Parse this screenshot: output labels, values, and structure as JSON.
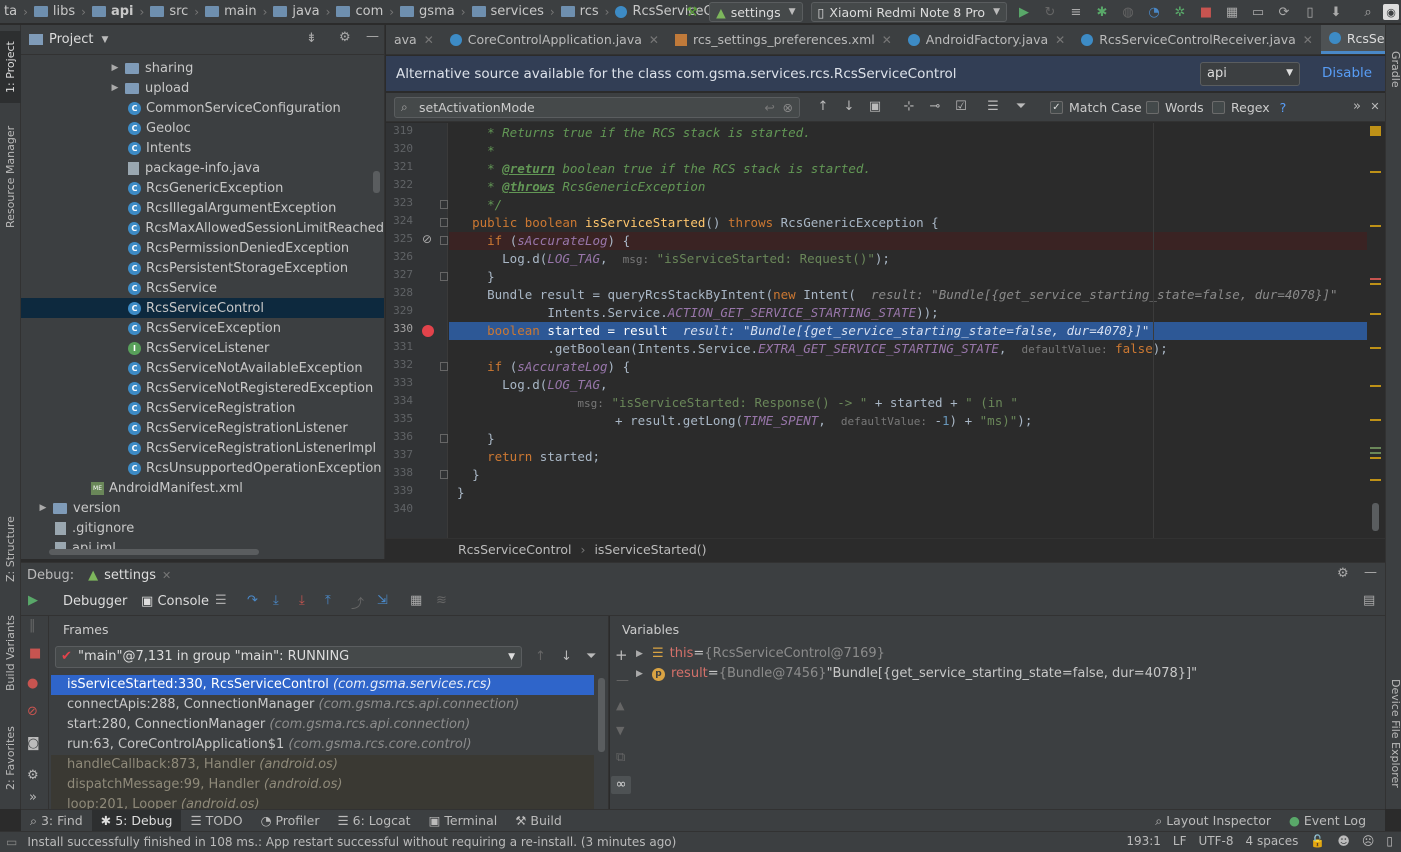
{
  "navbar": {
    "crumbs": [
      "ta",
      "libs",
      "api",
      "src",
      "main",
      "java",
      "com",
      "gsma",
      "services",
      "rcs",
      "RcsServiceControl"
    ],
    "run_config": "settings",
    "device": "Xiaomi Redmi Note 8 Pro"
  },
  "project": {
    "title": "Project",
    "items": [
      {
        "label": "sharing",
        "kind": "folder",
        "expandable": true,
        "indent": 1
      },
      {
        "label": "upload",
        "kind": "folder",
        "expandable": true,
        "indent": 1
      },
      {
        "label": "CommonServiceConfiguration",
        "kind": "class",
        "indent": 2
      },
      {
        "label": "Geoloc",
        "kind": "class",
        "indent": 2
      },
      {
        "label": "Intents",
        "kind": "class",
        "indent": 2
      },
      {
        "label": "package-info.java",
        "kind": "file",
        "indent": 2
      },
      {
        "label": "RcsGenericException",
        "kind": "class",
        "indent": 2
      },
      {
        "label": "RcsIllegalArgumentException",
        "kind": "class",
        "indent": 2
      },
      {
        "label": "RcsMaxAllowedSessionLimitReached",
        "kind": "class",
        "indent": 2
      },
      {
        "label": "RcsPermissionDeniedException",
        "kind": "class",
        "indent": 2
      },
      {
        "label": "RcsPersistentStorageException",
        "kind": "class",
        "indent": 2
      },
      {
        "label": "RcsService",
        "kind": "class",
        "indent": 2
      },
      {
        "label": "RcsServiceControl",
        "kind": "class",
        "indent": 2,
        "selected": true
      },
      {
        "label": "RcsServiceException",
        "kind": "class",
        "indent": 2
      },
      {
        "label": "RcsServiceListener",
        "kind": "interface",
        "indent": 2
      },
      {
        "label": "RcsServiceNotAvailableException",
        "kind": "class",
        "indent": 2
      },
      {
        "label": "RcsServiceNotRegisteredException",
        "kind": "class",
        "indent": 2
      },
      {
        "label": "RcsServiceRegistration",
        "kind": "class",
        "indent": 2
      },
      {
        "label": "RcsServiceRegistrationListener",
        "kind": "class",
        "indent": 2
      },
      {
        "label": "RcsServiceRegistrationListenerImpl",
        "kind": "class",
        "indent": 2
      },
      {
        "label": "RcsUnsupportedOperationException",
        "kind": "class",
        "indent": 2
      },
      {
        "label": "AndroidManifest.xml",
        "kind": "xml",
        "indent": 1
      },
      {
        "label": "version",
        "kind": "folder",
        "expandable": true,
        "indent": 0
      },
      {
        "label": ".gitignore",
        "kind": "file",
        "indent": 0
      },
      {
        "label": "api.iml",
        "kind": "file",
        "indent": 0
      }
    ]
  },
  "tabs": [
    {
      "label": "ava",
      "kind": "partial"
    },
    {
      "label": "CoreControlApplication.java",
      "kind": "class"
    },
    {
      "label": "rcs_settings_preferences.xml",
      "kind": "xml"
    },
    {
      "label": "AndroidFactory.java",
      "kind": "class"
    },
    {
      "label": "RcsServiceControlReceiver.java",
      "kind": "class"
    },
    {
      "label": "RcsServiceControl.java",
      "kind": "class",
      "active": true
    }
  ],
  "tabs_overflow": "5",
  "notice": {
    "message": "Alternative source available for the class com.gsma.services.rcs.RcsServiceControl",
    "source_select": "api",
    "disable_label": "Disable"
  },
  "find": {
    "query": "setActivationMode",
    "match_case_label": "Match Case",
    "match_case": true,
    "words_label": "Words",
    "regex_label": "Regex"
  },
  "editor": {
    "line_numbers": [
      "319",
      "320",
      "321",
      "322",
      "323",
      "324",
      "325",
      "326",
      "327",
      "328",
      "329",
      "330",
      "331",
      "332",
      "333",
      "334",
      "335",
      "336",
      "337",
      "338",
      "339",
      "340"
    ],
    "current_line": "330",
    "lines": [
      "* Returns true if the RCS stack is started.",
      "*",
      "* @return boolean true if the RCS stack is started.",
      "* @throws RcsGenericException",
      "*/",
      "public boolean isServiceStarted() throws RcsGenericException {",
      "if (sAccurateLog) {",
      "Log.d(LOG_TAG,  msg: \"isServiceStarted: Request()\");",
      "}",
      "Bundle result = queryRcsStackByIntent(new Intent(",
      "Intents.Service.ACTION_GET_SERVICE_STARTING_STATE));",
      "boolean started = result",
      ".getBoolean(Intents.Service.EXTRA_GET_SERVICE_STARTING_STATE,  defaultValue: false);",
      "if (sAccurateLog) {",
      "Log.d(LOG_TAG,",
      "msg: \"isServiceStarted: Response() -> \" + started + \" (in \"",
      "+ result.getLong(TIME_SPENT,  defaultValue: -1) + \"ms)\");",
      "}",
      "return started;",
      "}",
      "}",
      ""
    ],
    "inline_value_328": "result: \"Bundle[{get_service_starting_state=false, dur=4078}]\"",
    "inline_value_330": "result: \"Bundle[{get_service_starting_state=false, dur=4078}]\""
  },
  "breadcrumbs": [
    "RcsServiceControl",
    "isServiceStarted()"
  ],
  "debug": {
    "label": "Debug:",
    "session": "settings",
    "tab_debugger": "Debugger",
    "tab_console": "Console",
    "frames_title": "Frames",
    "variables_title": "Variables",
    "thread": "\"main\"@7,131 in group \"main\": RUNNING",
    "frames": [
      {
        "method": "isServiceStarted:330, RcsServiceControl",
        "pkg": "(com.gsma.services.rcs)",
        "selected": true
      },
      {
        "method": "connectApis:288, ConnectionManager",
        "pkg": "(com.gsma.rcs.api.connection)"
      },
      {
        "method": "start:280, ConnectionManager",
        "pkg": "(com.gsma.rcs.api.connection)"
      },
      {
        "method": "run:63, CoreControlApplication$1",
        "pkg": "(com.gsma.rcs.core.control)"
      },
      {
        "method": "handleCallback:873, Handler",
        "pkg": "(android.os)",
        "library": true
      },
      {
        "method": "dispatchMessage:99, Handler",
        "pkg": "(android.os)",
        "library": true
      },
      {
        "method": "loop:201, Looper",
        "pkg": "(android.os)",
        "library": true
      }
    ],
    "variables": [
      {
        "name": "this",
        "eq": "=",
        "type": "{RcsServiceControl@7169}",
        "value": ""
      },
      {
        "name": "result",
        "eq": "=",
        "type": "{Bundle@7456}",
        "value": "\"Bundle[{get_service_starting_state=false, dur=4078}]\""
      }
    ]
  },
  "tool_tabs": [
    {
      "label": "3: Find"
    },
    {
      "label": "5: Debug",
      "active": true
    },
    {
      "label": "TODO"
    },
    {
      "label": "Profiler"
    },
    {
      "label": "6: Logcat"
    },
    {
      "label": "Terminal"
    },
    {
      "label": "Build"
    }
  ],
  "tool_tabs_right": [
    "Layout Inspector",
    "Event Log"
  ],
  "status": {
    "message": "Install successfully finished in 108 ms.: App restart successful without requiring a re-install. (3 minutes ago)",
    "position": "193:1",
    "line_sep": "LF",
    "encoding": "UTF-8",
    "indent": "4 spaces"
  },
  "side_tabs": {
    "left": [
      "1: Project",
      "Resource Manager",
      "Z: Structure",
      "Build Variants",
      "2: Favorites"
    ],
    "right": [
      "Gradle",
      "Device File Explorer"
    ]
  },
  "colors": {
    "accent": "#4a88c7",
    "exec_line": "#2d5896",
    "breakpoint": "#e2434b",
    "selected_frame": "#2f65ca"
  }
}
